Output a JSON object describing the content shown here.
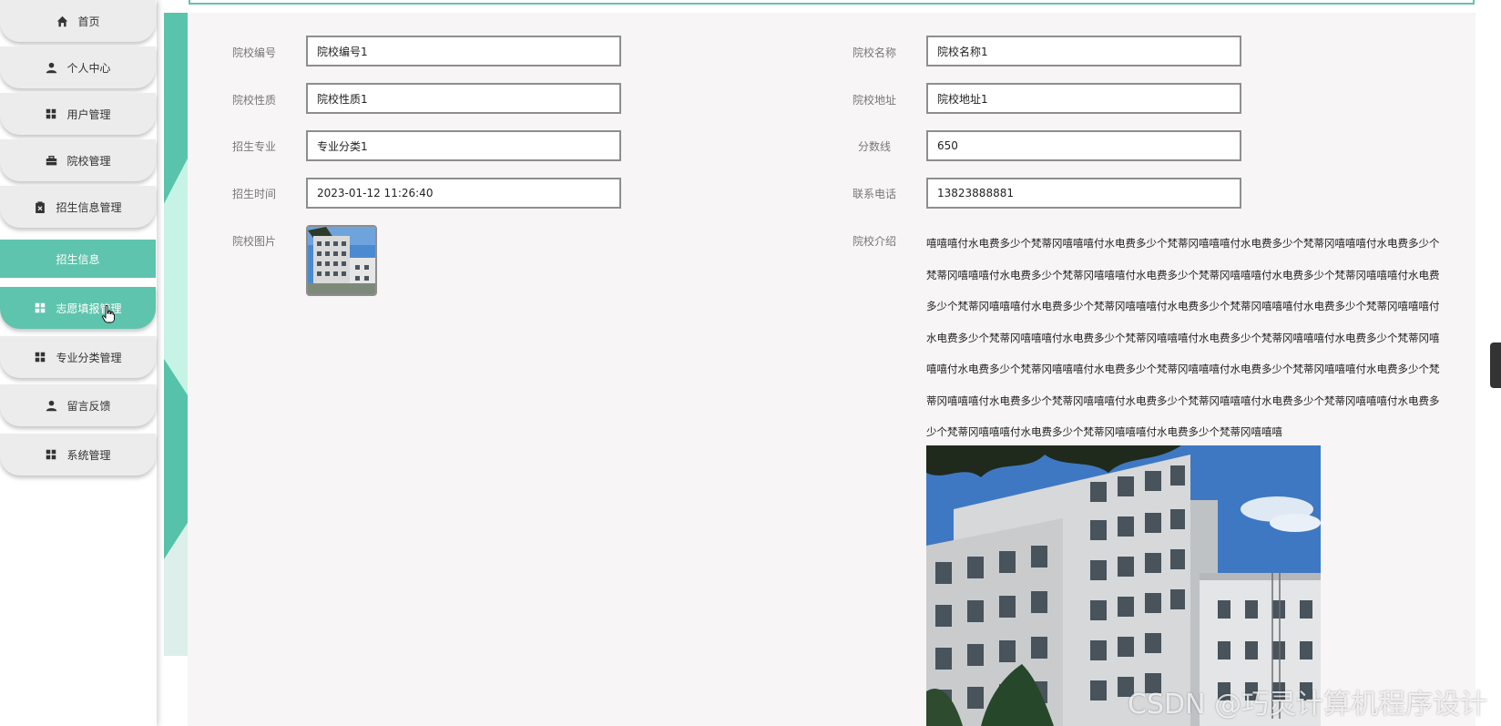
{
  "sidebar": {
    "items": [
      {
        "label": "首页",
        "icon": "home-icon"
      },
      {
        "label": "个人中心",
        "icon": "user-icon"
      },
      {
        "label": "用户管理",
        "icon": "grid-icon"
      },
      {
        "label": "院校管理",
        "icon": "briefcase-icon"
      },
      {
        "label": "招生信息管理",
        "icon": "clipboard-icon"
      },
      {
        "label": "招生信息",
        "icon": ""
      },
      {
        "label": "志愿填报管理",
        "icon": "grid-icon"
      },
      {
        "label": "专业分类管理",
        "icon": "grid-icon"
      },
      {
        "label": "留言反馈",
        "icon": "user-icon"
      },
      {
        "label": "系统管理",
        "icon": "grid-icon"
      }
    ]
  },
  "form": {
    "school_no": {
      "label": "院校编号",
      "value": "院校编号1"
    },
    "school_name": {
      "label": "院校名称",
      "value": "院校名称1"
    },
    "school_type": {
      "label": "院校性质",
      "value": "院校性质1"
    },
    "school_address": {
      "label": "院校地址",
      "value": "院校地址1"
    },
    "major": {
      "label": "招生专业",
      "value": "专业分类1"
    },
    "score_line": {
      "label": "分数线",
      "value": "650"
    },
    "enroll_time": {
      "label": "招生时间",
      "value": "2023-01-12 11:26:40"
    },
    "phone": {
      "label": "联系电话",
      "value": "13823888881"
    },
    "school_image": {
      "label": "院校图片"
    },
    "school_intro": {
      "label": "院校介绍",
      "text": "嘻嘻嘻付水电费多少个梵蒂冈嘻嘻嘻付水电费多少个梵蒂冈嘻嘻嘻付水电费多少个梵蒂冈嘻嘻嘻付水电费多少个梵蒂冈嘻嘻嘻付水电费多少个梵蒂冈嘻嘻嘻付水电费多少个梵蒂冈嘻嘻嘻付水电费多少个梵蒂冈嘻嘻嘻付水电费多少个梵蒂冈嘻嘻嘻付水电费多少个梵蒂冈嘻嘻嘻付水电费多少个梵蒂冈嘻嘻嘻付水电费多少个梵蒂冈嘻嘻嘻付水电费多少个梵蒂冈嘻嘻嘻付水电费多少个梵蒂冈嘻嘻嘻付水电费多少个梵蒂冈嘻嘻嘻付水电费多少个梵蒂冈嘻嘻嘻付水电费多少个梵蒂冈嘻嘻嘻付水电费多少个梵蒂冈嘻嘻嘻付水电费多少个梵蒂冈嘻嘻嘻付水电费多少个梵蒂冈嘻嘻嘻付水电费多少个梵蒂冈嘻嘻嘻付水电费多少个梵蒂冈嘻嘻嘻付水电费多少个梵蒂冈嘻嘻嘻付水电费多少个梵蒂冈嘻嘻嘻付水电费多少个梵蒂冈嘻嘻嘻付水电费多少个梵蒂冈嘻嘻嘻"
    }
  },
  "watermark": "CSDN @巧灵计算机程序设计",
  "colors": {
    "accent": "#5fc4ad",
    "menu_bg": "#ececec",
    "content_bg": "#f7f5f5",
    "input_border": "#8e8e8e"
  }
}
